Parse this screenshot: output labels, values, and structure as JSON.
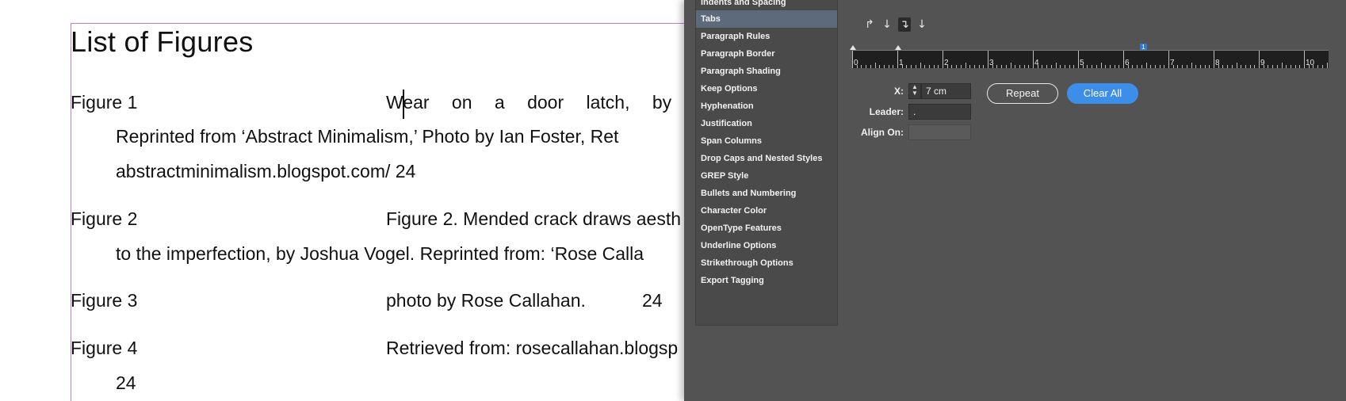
{
  "document": {
    "title": "List of Figures",
    "figures": [
      {
        "label": "Figure 1",
        "lines": [
          "Wear on a door latch, by",
          "Reprinted from ‘Abstract Minimalism,’ Photo by Ian Foster, Ret",
          "abstractminimalism.blogspot.com/ 24"
        ]
      },
      {
        "label": "Figure 2",
        "lines": [
          "Figure 2. Mended crack draws aesth",
          "to the imperfection, by Joshua Vogel. Reprinted from: ‘Rose Calla"
        ]
      },
      {
        "label": "Figure 3",
        "lines": [
          "photo by Rose Callahan.",
          "24"
        ]
      },
      {
        "label": "Figure 4",
        "lines": [
          "Retrieved from: rosecallahan.blogsp",
          "24"
        ]
      }
    ]
  },
  "panel": {
    "categories": [
      "Indents and Spacing",
      "Tabs",
      "Paragraph Rules",
      "Paragraph Border",
      "Paragraph Shading",
      "Keep Options",
      "Hyphenation",
      "Justification",
      "Span Columns",
      "Drop Caps and Nested Styles",
      "GREP Style",
      "Bullets and Numbering",
      "Character Color",
      "OpenType Features",
      "Underline Options",
      "Strikethrough Options",
      "Export Tagging"
    ],
    "selected_category": "Tabs",
    "tab_alignment_icons": [
      "left-justified-tab-icon",
      "center-justified-tab-icon",
      "right-justified-tab-icon",
      "align-to-decimal-tab-icon"
    ],
    "ruler_numbers": [
      "0",
      "1",
      "2",
      "3",
      "4",
      "5",
      "6",
      "7",
      "8",
      "9",
      "10"
    ],
    "tab_marker": "1",
    "x_label": "X:",
    "x_value": "7 cm",
    "leader_label": "Leader:",
    "leader_value": ".",
    "align_on_label": "Align On:",
    "align_on_value": "",
    "repeat_label": "Repeat",
    "clear_all_label": "Clear All"
  },
  "colors": {
    "panel_bg": "#535353",
    "selected_item": "#5d6a7c",
    "accent": "#3d8ee8",
    "margin_guide": "#c97ad1"
  }
}
